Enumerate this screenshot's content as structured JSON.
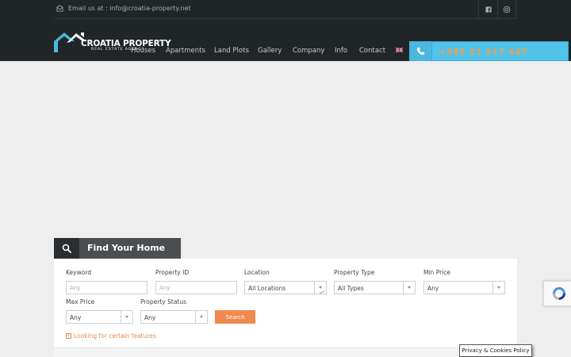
{
  "topbar": {
    "email_text": "Email us at : info@croatia-property.net"
  },
  "logo": {
    "name": "CROATIA PROPERTY",
    "tagline": "REAL ESTATE AGENCY"
  },
  "nav": {
    "items": [
      {
        "label": "Houses"
      },
      {
        "label": "Apartments"
      },
      {
        "label": "Land Plots"
      },
      {
        "label": "Gallery"
      },
      {
        "label": "Company"
      },
      {
        "label": "Info"
      },
      {
        "label": "Contact"
      }
    ]
  },
  "phone": {
    "number": "+385 21 317 447"
  },
  "search": {
    "tab_title": "Find Your Home",
    "keyword": {
      "label": "Keyword",
      "placeholder": "Any"
    },
    "property_id": {
      "label": "Property ID",
      "placeholder": "Any"
    },
    "location": {
      "label": "Location",
      "value": "All Locations"
    },
    "property_type": {
      "label": "Property Type",
      "value": "All Types"
    },
    "min_price": {
      "label": "Min Price",
      "value": "Any"
    },
    "max_price": {
      "label": "Max Price",
      "value": "Any"
    },
    "property_status": {
      "label": "Property Status",
      "value": "Any"
    },
    "search_button": "Search",
    "features_link": "Looking for certain features"
  },
  "privacy": {
    "label": "Privacy & Cookies Policy"
  },
  "colors": {
    "header_bg": "#202527",
    "accent_orange": "#f0894d",
    "phone_blue": "#52c4ec"
  }
}
